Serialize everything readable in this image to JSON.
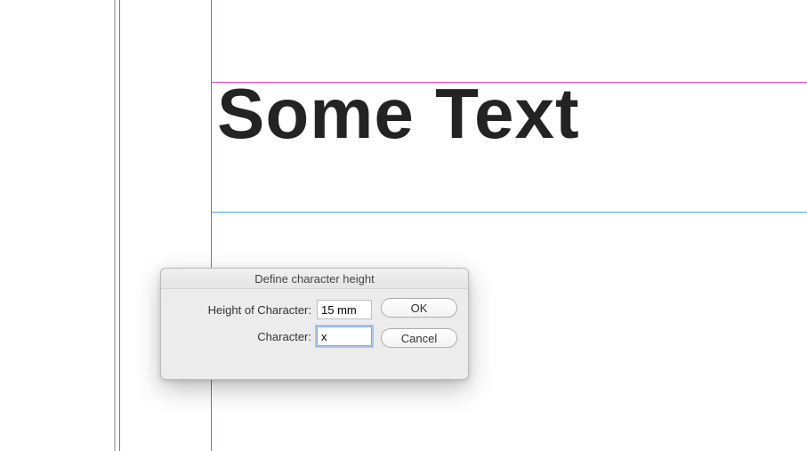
{
  "document": {
    "sample_text": "Some Text"
  },
  "dialog": {
    "title": "Define character height",
    "fields": {
      "height_label": "Height of Character:",
      "height_value": "15 mm",
      "char_label": "Character:",
      "char_value": "x"
    },
    "buttons": {
      "ok": "OK",
      "cancel": "Cancel"
    }
  }
}
